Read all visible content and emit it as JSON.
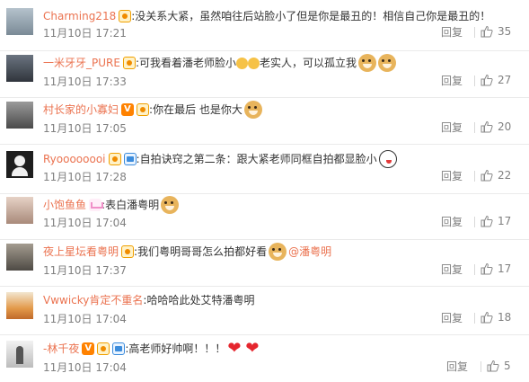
{
  "comments": [
    {
      "username": "Charming218",
      "badges": [
        "vip"
      ],
      "colon": ":",
      "text": "没关系大紧，虽然咱往后站脸小了但是你是最丑的！相信自己你是最丑的！",
      "emoji": [],
      "time": "11月10日 17:21",
      "reply_label": "回复",
      "likes": "35",
      "avatar_color": "#8a9aa8"
    },
    {
      "username": "一米牙牙_PURE",
      "badges": [
        "vip"
      ],
      "colon": ":",
      "text_parts": [
        "可我看着潘老师脸小",
        "",
        "",
        "老实人，可以孤立我"
      ],
      "emoji": [
        "small",
        "small",
        "doge",
        "doge"
      ],
      "time": "11月10日 17:33",
      "reply_label": "回复",
      "likes": "27",
      "avatar_color": "#444b55"
    },
    {
      "username": "村长家的小寡妇",
      "badges": [
        "v",
        "vip"
      ],
      "colon": ":",
      "text": "你在最后 也是你大",
      "emoji": [
        "doge"
      ],
      "time": "11月10日 17:05",
      "reply_label": "回复",
      "likes": "20",
      "avatar_color": "#5a5a5a"
    },
    {
      "username": "Ryoooooooi",
      "badges": [
        "vip",
        "fan"
      ],
      "colon": ":",
      "text": "自拍诀窍之第二条：跟大紧老师同框自拍都显脸小",
      "emoji": [
        "awkward"
      ],
      "time": "11月10日 17:28",
      "reply_label": "回复",
      "likes": "22",
      "avatar_color": "#222222"
    },
    {
      "username": "小饱鱼鱼",
      "badges": [
        "crown"
      ],
      "colon": ":",
      "text": "表白潘粤明",
      "emoji": [
        "doge"
      ],
      "time": "11月10日 17:04",
      "reply_label": "回复",
      "likes": "17",
      "avatar_color": "#c8a898"
    },
    {
      "username": "夜上星坛看粤明",
      "badges": [
        "vip"
      ],
      "colon": ":",
      "text": "我们粤明哥哥怎么拍都好看",
      "emoji": [
        "doge"
      ],
      "mention": "@潘粤明",
      "time": "11月10日 17:37",
      "reply_label": "回复",
      "likes": "17",
      "avatar_color": "#6a6258"
    },
    {
      "username": "Vwwicky肯定不重名",
      "badges": [],
      "colon": ":",
      "text": "哈哈哈此处艾特潘粤明",
      "emoji": [],
      "time": "11月10日 17:04",
      "reply_label": "回复",
      "likes": "18",
      "avatar_color": "#e0a060"
    },
    {
      "username": "-林千夜",
      "badges": [
        "v",
        "vip",
        "fan"
      ],
      "colon": ":",
      "text": "高老师好帅啊！！！",
      "emoji": [
        "heart",
        "heart"
      ],
      "time": "11月10日 17:04",
      "reply_label": "回复",
      "likes": "5",
      "avatar_color": "#d8d8d8"
    }
  ]
}
